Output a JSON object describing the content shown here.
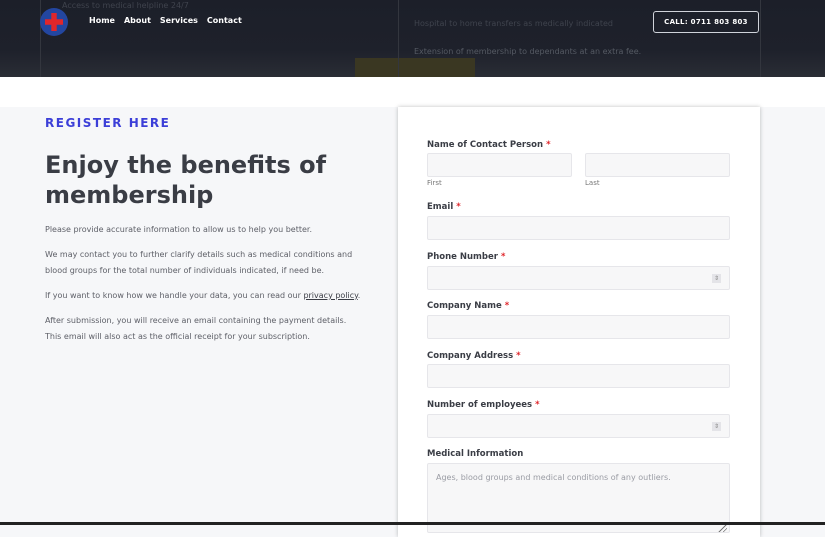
{
  "header": {
    "bg_lines": [
      "Access to medical helpline 24/7",
      "Hospital to home transfers as medically indicated",
      "Extension of membership to dependants at an extra fee."
    ],
    "nav": [
      "Home",
      "About",
      "Services",
      "Contact"
    ],
    "call_button": "CALL: 0711 803 803"
  },
  "intro": {
    "kicker": "REGISTER HERE",
    "title": "Enjoy the benefits of membership",
    "p1": "Please provide accurate information to allow us to help you better.",
    "p2": "We may contact you to further clarify details such as medical conditions and blood groups for the total number of individuals indicated, if need be.",
    "p3_before": "If you want to know how we handle your data, you can read our ",
    "p3_link": "privacy policy",
    "p3_after": ".",
    "p4": "After submission, you will receive an email containing the payment details. This email will also act as the official receipt for your subscription."
  },
  "form": {
    "required_mark": "*",
    "name_label": "Name of Contact Person",
    "first": "First",
    "last": "Last",
    "email_label": "Email",
    "phone_label": "Phone Number",
    "company_label": "Company Name",
    "address_label": "Company Address",
    "employees_label": "Number of employees",
    "medical_label": "Medical Information",
    "medical_placeholder": "Ages, blood groups and medical conditions of any outliers.",
    "spinner": "⇕"
  }
}
